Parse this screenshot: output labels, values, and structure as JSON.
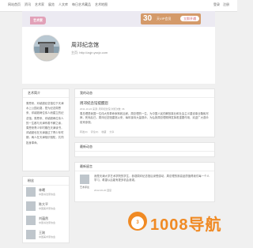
{
  "topnav": {
    "links": [
      "网站首页",
      "资讯",
      "艺术家",
      "展览",
      "人文库",
      "每日艺术藏品",
      "艺术地图"
    ],
    "login": "登录",
    "register": "注册"
  },
  "banner": {
    "logo": "艺术家",
    "ad_number": "30",
    "ad_text": "天VIP会员",
    "ad_button": "立即开通"
  },
  "profile": {
    "name": "周邓纪念馆",
    "url": "主页: http://zqjn.ysxjz.com"
  },
  "intro": {
    "heading": "艺术简介",
    "text": "周恩来、邓颖超纪念馆位于天津水上公园北路，是为纪念周恩来、邓颖超两位伟人而建立的纪念馆。周恩来、邓颖超两位伟人的一生都与天津有着不解之缘，周恩来青少年时期在天津读书，邓颖超也在天津度过了青少年时期，两人在天津相识相知，共同投身革命。"
  },
  "fans": {
    "heading": "粉丝",
    "items": [
      {
        "name": "林曦",
        "desc": "中国书法家协会"
      },
      {
        "name": "陈大平",
        "desc": "中国美术家协会"
      },
      {
        "name": "刘蕴然",
        "desc": "中国书法家协会"
      },
      {
        "name": "王刚",
        "desc": "中国美术家协会"
      }
    ]
  },
  "news": {
    "heading": "我的动态",
    "title": "周邓纪念馆提醒您",
    "meta": "2011-10-22  来源: 周邓纪念馆  浏览次数: 36",
    "body": "周总理是我国一位伟大的革命家和政治家。周总理的一生，为中国人民的解放事业和社会主义建设事业鞠躬尽瘁，死而后已。周邓纪念馆建馆以来，每年接待大量观众，为弘扬周总理精神发挥着重要作用，欢迎广大观众前来参观。",
    "actions": [
      "转发(0)",
      "评论(0)",
      "收藏",
      "分享"
    ]
  },
  "recent": {
    "heading": "最新动态"
  },
  "messages": {
    "heading": "最新留言",
    "name": "艺术评论",
    "text": "我是天津大学艺术学院的学生，参观周邓纪念馆后深受感动，周总理的崇高品质值得我们每一个人学习，希望以后能有更多机会参观。",
    "time": "2012-06-20  回复"
  },
  "watermark": {
    "number": "3",
    "text": "1008导航"
  }
}
